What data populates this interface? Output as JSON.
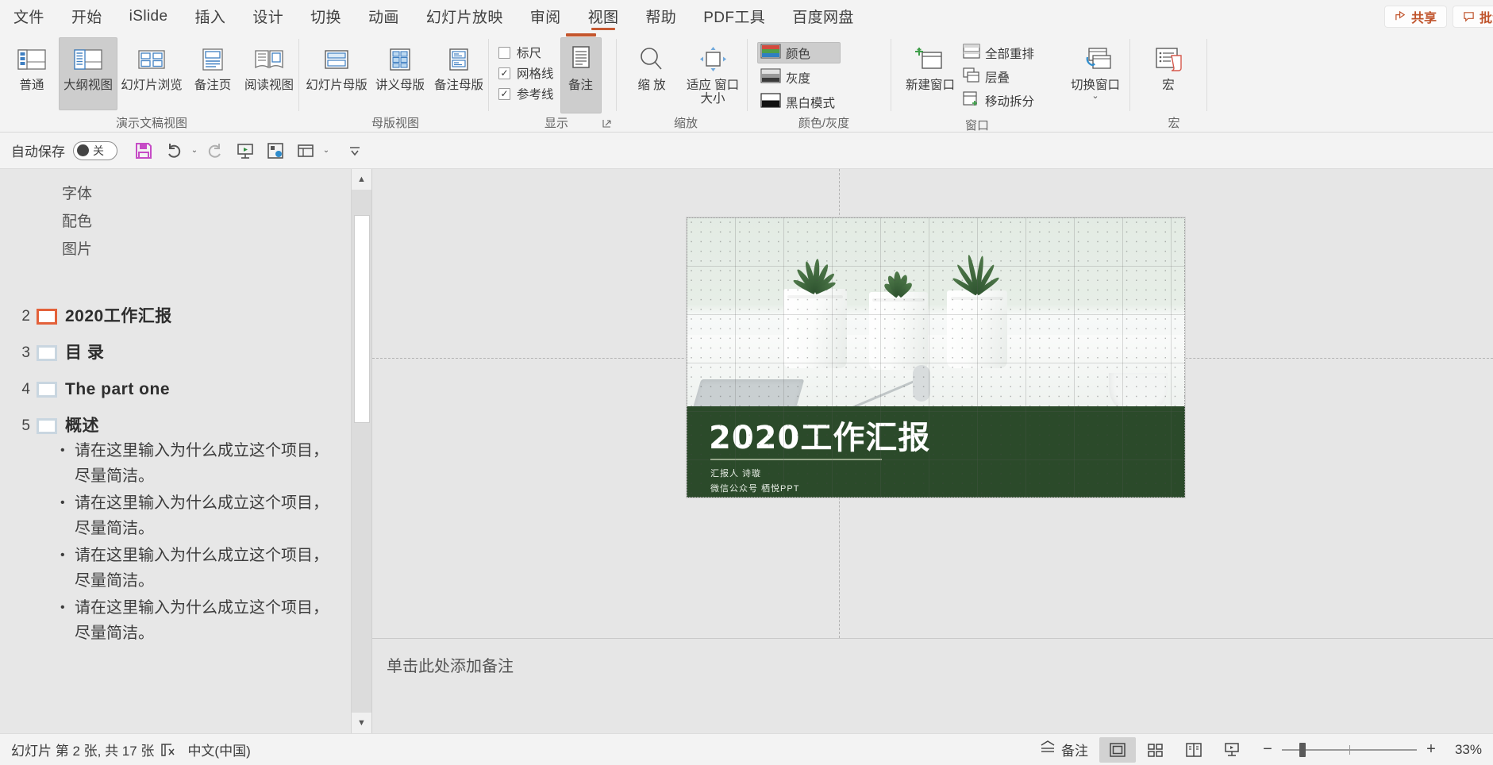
{
  "tabs": [
    {
      "label": "文件",
      "active": false
    },
    {
      "label": "开始",
      "active": false
    },
    {
      "label": "iSlide",
      "active": false
    },
    {
      "label": "插入",
      "active": false
    },
    {
      "label": "设计",
      "active": false
    },
    {
      "label": "切换",
      "active": false
    },
    {
      "label": "动画",
      "active": false
    },
    {
      "label": "幻灯片放映",
      "active": false
    },
    {
      "label": "审阅",
      "active": false
    },
    {
      "label": "视图",
      "active": true
    },
    {
      "label": "帮助",
      "active": false
    },
    {
      "label": "PDF工具",
      "active": false
    },
    {
      "label": "百度网盘",
      "active": false
    }
  ],
  "titlebar_right": {
    "share_label": "共享",
    "comment_label": "批注",
    "accent_color": "#c0542c"
  },
  "ribbon": {
    "groups": [
      {
        "name": "presentation-views",
        "label": "演示文稿视图",
        "buttons": [
          {
            "label": "普通",
            "icon": "normal-view-icon",
            "selected": false
          },
          {
            "label": "大纲视图",
            "icon": "outline-view-icon",
            "selected": true
          },
          {
            "label": "幻灯片浏览",
            "icon": "slide-sorter-icon",
            "selected": false
          },
          {
            "label": "备注页",
            "icon": "notes-page-icon",
            "selected": false
          },
          {
            "label": "阅读视图",
            "icon": "reading-view-icon",
            "selected": false
          }
        ]
      },
      {
        "name": "master-views",
        "label": "母版视图",
        "buttons": [
          {
            "label": "幻灯片母版",
            "icon": "slide-master-icon",
            "selected": false
          },
          {
            "label": "讲义母版",
            "icon": "handout-master-icon",
            "selected": false
          },
          {
            "label": "备注母版",
            "icon": "notes-master-icon",
            "selected": false
          }
        ]
      },
      {
        "name": "show",
        "label": "显示",
        "checkboxes": [
          {
            "label": "标尺",
            "checked": false
          },
          {
            "label": "网格线",
            "checked": true
          },
          {
            "label": "参考线",
            "checked": true
          }
        ],
        "buttons": [
          {
            "label": "备注",
            "icon": "notes-icon",
            "selected": true
          }
        ],
        "has_dialog_launcher": true
      },
      {
        "name": "zoom",
        "label": "缩放",
        "buttons": [
          {
            "label": "缩 放",
            "icon": "magnifier-icon",
            "selected": false
          },
          {
            "label": "适应 窗口大小",
            "icon": "fit-window-icon",
            "selected": false
          }
        ]
      },
      {
        "name": "color-grayscale",
        "label": "颜色/灰度",
        "smallbuttons": [
          {
            "label": "颜色",
            "icon": "color-swatch-icon",
            "selected": true
          },
          {
            "label": "灰度",
            "icon": "grayscale-swatch-icon",
            "selected": false
          },
          {
            "label": "黑白模式",
            "icon": "blackwhite-swatch-icon",
            "selected": false
          }
        ]
      },
      {
        "name": "window",
        "label": "窗口",
        "buttons": [
          {
            "label": "新建窗口",
            "icon": "new-window-icon",
            "selected": false
          },
          {
            "label": "切换窗口",
            "icon": "switch-window-icon",
            "selected": false,
            "has_caret": true
          }
        ],
        "smallbuttons": [
          {
            "label": "全部重排",
            "icon": "arrange-all-icon",
            "selected": false
          },
          {
            "label": "层叠",
            "icon": "cascade-icon",
            "selected": false
          },
          {
            "label": "移动拆分",
            "icon": "move-split-icon",
            "selected": false
          }
        ]
      },
      {
        "name": "macros",
        "label": "宏",
        "buttons": [
          {
            "label": "宏",
            "icon": "macro-icon",
            "selected": false
          }
        ]
      }
    ]
  },
  "quick_access": {
    "autosave_label": "自动保存",
    "autosave_state": "关",
    "icons": [
      {
        "name": "save-icon"
      },
      {
        "name": "undo-icon"
      },
      {
        "name": "redo-icon"
      },
      {
        "name": "start-slideshow-icon"
      },
      {
        "name": "custom-icon"
      },
      {
        "name": "layout-icon"
      },
      {
        "name": "more-icon"
      }
    ]
  },
  "outline": {
    "sub_lines": [
      "字体",
      "配色",
      "图片"
    ],
    "slides": [
      {
        "num": "2",
        "title": "2020工作汇报",
        "current": true,
        "bullets": []
      },
      {
        "num": "3",
        "title": "目 录",
        "current": false,
        "bullets": []
      },
      {
        "num": "4",
        "title": "The part one",
        "current": false,
        "bullets": []
      },
      {
        "num": "5",
        "title": "概述",
        "current": false,
        "bullets": [
          "请在这里输入为什么成立这个项目，尽量简洁。",
          "请在这里输入为什么成立这个项目，尽量简洁。",
          "请在这里输入为什么成立这个项目，尽量简洁。",
          "请在这里输入为什么成立这个项目，尽量简洁。"
        ]
      }
    ]
  },
  "slide": {
    "title": "2020工作汇报",
    "subtitle_1": "汇报人 诗璇",
    "subtitle_2": "微信公众号 栖悦PPT",
    "band_color": "#2b4a2a"
  },
  "notes_pane": {
    "placeholder": "单击此处添加备注"
  },
  "status_bar": {
    "slide_count_text": "幻灯片 第 2 张, 共 17 张",
    "accessibility_icon": "accessibility-check-icon",
    "language": "中文(中国)",
    "notes_label": "备注",
    "views": [
      {
        "name": "normal-view-button",
        "selected": true
      },
      {
        "name": "slide-sorter-button",
        "selected": false
      },
      {
        "name": "reading-view-button",
        "selected": false
      },
      {
        "name": "slideshow-button",
        "selected": false
      }
    ],
    "zoom_out": "−",
    "zoom_in": "+",
    "zoom_value": "33%"
  }
}
